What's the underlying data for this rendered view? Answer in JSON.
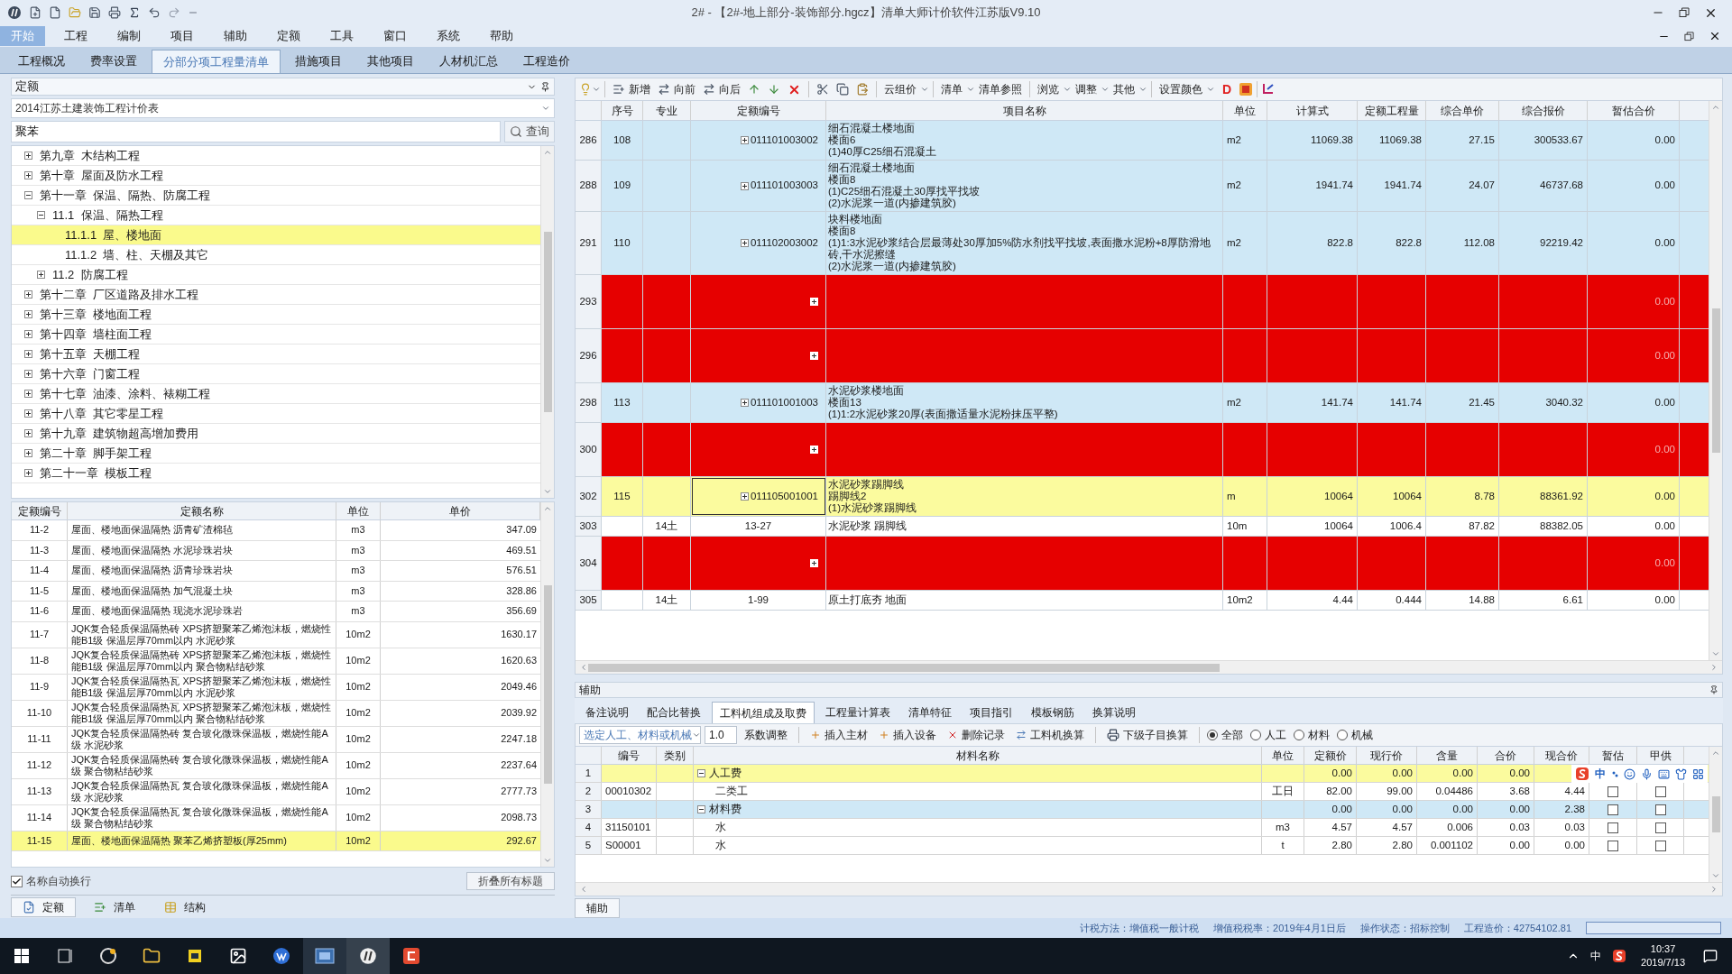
{
  "window": {
    "title": "2# - 【2#-地上部分-装饰部分.hgcz】清单大师计价软件江苏版V9.10"
  },
  "menu": [
    {
      "label": "开始",
      "selected": true
    },
    {
      "label": "工程",
      "selected": false
    },
    {
      "label": "编制",
      "selected": false
    },
    {
      "label": "项目",
      "selected": false
    },
    {
      "label": "辅助",
      "selected": false
    },
    {
      "label": "定额",
      "selected": false
    },
    {
      "label": "工具",
      "selected": false
    },
    {
      "label": "窗口",
      "selected": false
    },
    {
      "label": "系统",
      "selected": false
    },
    {
      "label": "帮助",
      "selected": false
    }
  ],
  "tabs": [
    {
      "label": "工程概况",
      "selected": false
    },
    {
      "label": "费率设置",
      "selected": false
    },
    {
      "label": "分部分项工程量清单",
      "selected": true
    },
    {
      "label": "措施项目",
      "selected": false
    },
    {
      "label": "其他项目",
      "selected": false
    },
    {
      "label": "人材机汇总",
      "selected": false
    },
    {
      "label": "工程造价",
      "selected": false
    }
  ],
  "left_panel": {
    "mode": "定额",
    "library": "2014江苏土建装饰工程计价表",
    "search": {
      "value": "聚苯",
      "button": "查询"
    },
    "tree": [
      {
        "label": "第九章  木结构工程",
        "expanded": false,
        "selected": false
      },
      {
        "label": "第十章  屋面及防水工程",
        "expanded": false,
        "selected": false
      },
      {
        "label": "第十一章  保温、隔热、防腐工程",
        "expanded": true,
        "selected": false,
        "children": [
          {
            "label": "11.1  保温、隔热工程",
            "expanded": true,
            "selected": false,
            "children": [
              {
                "label": "11.1.1  屋、楼地面",
                "selected": true
              },
              {
                "label": "11.1.2  墙、柱、天棚及其它",
                "selected": false
              }
            ]
          },
          {
            "label": "11.2  防腐工程",
            "expanded": false,
            "selected": false
          }
        ]
      },
      {
        "label": "第十二章  厂区道路及排水工程",
        "expanded": false,
        "selected": false
      },
      {
        "label": "第十三章  楼地面工程",
        "expanded": false,
        "selected": false
      },
      {
        "label": "第十四章  墙柱面工程",
        "expanded": false,
        "selected": false
      },
      {
        "label": "第十五章  天棚工程",
        "expanded": false,
        "selected": false
      },
      {
        "label": "第十六章  门窗工程",
        "expanded": false,
        "selected": false
      },
      {
        "label": "第十七章  油漆、涂料、裱糊工程",
        "expanded": false,
        "selected": false
      },
      {
        "label": "第十八章  其它零星工程",
        "expanded": false,
        "selected": false
      },
      {
        "label": "第十九章  建筑物超高增加费用",
        "expanded": false,
        "selected": false
      },
      {
        "label": "第二十章  脚手架工程",
        "expanded": false,
        "selected": false
      },
      {
        "label": "第二十一章  模板工程",
        "expanded": false,
        "selected": false
      }
    ],
    "quota_table": {
      "columns": [
        "定额编号",
        "定额名称",
        "单位",
        "单价"
      ],
      "rows": [
        {
          "code": "11-2",
          "name": "屋面、楼地面保温隔热 沥青矿渣棉毡",
          "unit": "m3",
          "price": "347.09",
          "selected": false
        },
        {
          "code": "11-3",
          "name": "屋面、楼地面保温隔热 水泥珍珠岩块",
          "unit": "m3",
          "price": "469.51",
          "selected": false
        },
        {
          "code": "11-4",
          "name": "屋面、楼地面保温隔热 沥青珍珠岩块",
          "unit": "m3",
          "price": "576.51",
          "selected": false
        },
        {
          "code": "11-5",
          "name": "屋面、楼地面保温隔热 加气混凝土块",
          "unit": "m3",
          "price": "328.86",
          "selected": false
        },
        {
          "code": "11-6",
          "name": "屋面、楼地面保温隔热 现浇水泥珍珠岩",
          "unit": "m3",
          "price": "356.69",
          "selected": false
        },
        {
          "code": "11-7",
          "name": "JQK复合轻质保温隔热砖 XPS挤塑聚苯乙烯泡沫板，燃烧性能B1级 保温层厚70mm以内 水泥砂浆",
          "unit": "10m2",
          "price": "1630.17",
          "selected": false
        },
        {
          "code": "11-8",
          "name": "JQK复合轻质保温隔热砖 XPS挤塑聚苯乙烯泡沫板，燃烧性能B1级 保温层厚70mm以内 聚合物粘结砂浆",
          "unit": "10m2",
          "price": "1620.63",
          "selected": false
        },
        {
          "code": "11-9",
          "name": "JQK复合轻质保温隔热瓦 XPS挤塑聚苯乙烯泡沫板，燃烧性能B1级 保温层厚70mm以内 水泥砂浆",
          "unit": "10m2",
          "price": "2049.46",
          "selected": false
        },
        {
          "code": "11-10",
          "name": "JQK复合轻质保温隔热瓦 XPS挤塑聚苯乙烯泡沫板，燃烧性能B1级 保温层厚70mm以内 聚合物粘结砂浆",
          "unit": "10m2",
          "price": "2039.92",
          "selected": false
        },
        {
          "code": "11-11",
          "name": "JQK复合轻质保温隔热砖 复合玻化微珠保温板，燃烧性能A级 水泥砂浆",
          "unit": "10m2",
          "price": "2247.18",
          "selected": false
        },
        {
          "code": "11-12",
          "name": "JQK复合轻质保温隔热砖 复合玻化微珠保温板，燃烧性能A级 聚合物粘结砂浆",
          "unit": "10m2",
          "price": "2237.64",
          "selected": false
        },
        {
          "code": "11-13",
          "name": "JQK复合轻质保温隔热瓦 复合玻化微珠保温板，燃烧性能A级 水泥砂浆",
          "unit": "10m2",
          "price": "2777.73",
          "selected": false
        },
        {
          "code": "11-14",
          "name": "JQK复合轻质保温隔热瓦 复合玻化微珠保温板，燃烧性能A级 聚合物粘结砂浆",
          "unit": "10m2",
          "price": "2098.73",
          "selected": false
        },
        {
          "code": "11-15",
          "name": "屋面、楼地面保温隔热 聚苯乙烯挤塑板(厚25mm)",
          "unit": "10m2",
          "price": "292.67",
          "selected": true
        }
      ]
    },
    "auto_wrap": {
      "label": "名称自动换行",
      "checked": true
    },
    "collapse_button": "折叠所有标题",
    "bottom_tabs": [
      {
        "label": "定额",
        "selected": true
      },
      {
        "label": "清单",
        "selected": false
      },
      {
        "label": "结构",
        "selected": false
      }
    ]
  },
  "toolbar": {
    "add": "新增",
    "forward": "向前",
    "backward": "向后",
    "cloud": "云组价",
    "bill": "清单",
    "bill_ref": "清单参照",
    "browse": "浏览",
    "adjust": "调整",
    "other": "其他",
    "color_settings": "设置颜色",
    "d": "D"
  },
  "grid": {
    "columns": [
      "序号",
      "专业",
      "定额编号",
      "项目名称",
      "单位",
      "计算式",
      "定额工程量",
      "综合单价",
      "综合报价",
      "暂估合价"
    ],
    "rows": [
      {
        "row_no": "286",
        "kind": "bill",
        "selected": false,
        "seq": "108",
        "code": "011101003002",
        "name_lines": [
          "细石混凝土楼地面",
          "楼面6",
          "(1)40厚C25细石混凝土"
        ],
        "unit": "m2",
        "formula": "11069.38",
        "qty": "11069.38",
        "unit_price": "27.15",
        "total": "300533.67",
        "provisional": "0.00"
      },
      {
        "row_no": "288",
        "kind": "bill",
        "selected": false,
        "seq": "109",
        "code": "011101003003",
        "name_lines": [
          "细石混凝土楼地面",
          "楼面8",
          "(1)C25细石混凝土30厚找平找坡",
          "(2)水泥浆一道(内掺建筑胶)"
        ],
        "unit": "m2",
        "formula": "1941.74",
        "qty": "1941.74",
        "unit_price": "24.07",
        "total": "46737.68",
        "provisional": "0.00"
      },
      {
        "row_no": "291",
        "kind": "bill",
        "selected": false,
        "seq": "110",
        "code": "011102003002",
        "name_lines": [
          "块料楼地面",
          "楼面8",
          "(1)1:3水泥砂浆结合层最薄处30厚加5%防水剂找平找坡,表面撒水泥粉+8厚防滑地砖,干水泥擦缝",
          "(2)水泥浆一道(内掺建筑胶)"
        ],
        "unit": "m2",
        "formula": "822.8",
        "qty": "822.8",
        "unit_price": "112.08",
        "total": "92219.42",
        "provisional": "0.00"
      },
      {
        "row_no": "293",
        "kind": "flagged",
        "selected": false,
        "provisional": "0.00"
      },
      {
        "row_no": "296",
        "kind": "flagged",
        "selected": false,
        "provisional": "0.00"
      },
      {
        "row_no": "298",
        "kind": "bill",
        "selected": false,
        "seq": "113",
        "code": "011101001003",
        "name_lines": [
          "水泥砂浆楼地面",
          "楼面13",
          "(1)1:2水泥砂浆20厚(表面撒适量水泥粉抹压平整)"
        ],
        "unit": "m2",
        "formula": "141.74",
        "qty": "141.74",
        "unit_price": "21.45",
        "total": "3040.32",
        "provisional": "0.00"
      },
      {
        "row_no": "300",
        "kind": "flagged",
        "selected": false,
        "provisional": "0.00"
      },
      {
        "row_no": "302",
        "kind": "bill",
        "selected": true,
        "seq": "115",
        "code": "011105001001",
        "name_lines": [
          "水泥砂浆踢脚线",
          "踢脚线2",
          "(1)水泥砂浆踢脚线"
        ],
        "unit": "m",
        "formula": "10064",
        "qty": "10064",
        "unit_price": "8.78",
        "total": "88361.92",
        "provisional": "0.00"
      },
      {
        "row_no": "303",
        "kind": "quota",
        "selected": false,
        "specialty": "14土",
        "code": "13-27",
        "name_lines": [
          "水泥砂浆 踢脚线"
        ],
        "unit": "10m",
        "formula": "10064",
        "qty": "1006.4",
        "unit_price": "87.82",
        "total": "88382.05",
        "provisional": "0.00"
      },
      {
        "row_no": "304",
        "kind": "flagged",
        "selected": false,
        "provisional": "0.00"
      },
      {
        "row_no": "305",
        "kind": "quota",
        "selected": false,
        "specialty": "14土",
        "code": "1-99",
        "name_lines": [
          "原土打底夯 地面"
        ],
        "unit": "10m2",
        "formula": "4.44",
        "qty": "0.444",
        "unit_price": "14.88",
        "total": "6.61",
        "provisional": "0.00"
      }
    ]
  },
  "aux": {
    "title": "辅助",
    "tabs": [
      {
        "label": "备注说明",
        "selected": false
      },
      {
        "label": "配合比替换",
        "selected": false
      },
      {
        "label": "工料机组成及取费",
        "selected": true
      },
      {
        "label": "工程量计算表",
        "selected": false
      },
      {
        "label": "清单特征",
        "selected": false
      },
      {
        "label": "项目指引",
        "selected": false
      },
      {
        "label": "模板钢筋",
        "selected": false
      },
      {
        "label": "换算说明",
        "selected": false
      }
    ],
    "selector": "选定人工、材料或机械",
    "factor": "1.0",
    "factor_button": "系数调整",
    "actions": [
      "插入主材",
      "插入设备",
      "删除记录",
      "工料机换算"
    ],
    "sub_button": "下级子目换算",
    "filters": [
      {
        "label": "全部",
        "selected": true
      },
      {
        "label": "人工",
        "selected": false
      },
      {
        "label": "材料",
        "selected": false
      },
      {
        "label": "机械",
        "selected": false
      }
    ],
    "columns": [
      "编号",
      "类别",
      "材料名称",
      "单位",
      "定额价",
      "现行价",
      "含量",
      "合价",
      "现合价",
      "暂估",
      "甲供"
    ],
    "rows": [
      {
        "idx": "1",
        "kind": "group",
        "selected": true,
        "expanded": true,
        "name": "人工费",
        "quota_price": "0.00",
        "current_price": "0.00",
        "content": "0.00",
        "total": "0.00"
      },
      {
        "idx": "2",
        "kind": "item",
        "selected": false,
        "code": "00010302",
        "name": "二类工",
        "unit": "工日",
        "quota_price": "82.00",
        "current_price": "99.00",
        "content": "0.04486",
        "total": "3.68",
        "current_total": "4.44",
        "provisional": false,
        "supplied": false
      },
      {
        "idx": "3",
        "kind": "group",
        "selected": false,
        "expanded": true,
        "name": "材料费",
        "quota_price": "0.00",
        "current_price": "0.00",
        "content": "0.00",
        "total": "0.00",
        "current_total": "2.38",
        "provisional": false,
        "supplied": false
      },
      {
        "idx": "4",
        "kind": "item",
        "selected": false,
        "code": "31150101",
        "name": "水",
        "unit": "m3",
        "quota_price": "4.57",
        "current_price": "4.57",
        "content": "0.006",
        "total": "0.03",
        "current_total": "0.03",
        "provisional": false,
        "supplied": false
      },
      {
        "idx": "5",
        "kind": "item",
        "selected": false,
        "code": "S00001",
        "name": "水",
        "unit": "t",
        "quota_price": "2.80",
        "current_price": "2.80",
        "content": "0.001102",
        "total": "0.00",
        "current_total": "0.00",
        "provisional": false,
        "supplied": false
      }
    ],
    "bottom_tab": "辅助"
  },
  "ime": {
    "mode": "中"
  },
  "status_bar": [
    "计税方法：增值税一般计税",
    "增值税税率：2019年4月1日后",
    "操作状态：招标控制",
    "工程造价：42754102.81"
  ],
  "taskbar": {
    "tray_lang": "中",
    "time": "10:37",
    "date": "2019/7/13"
  }
}
